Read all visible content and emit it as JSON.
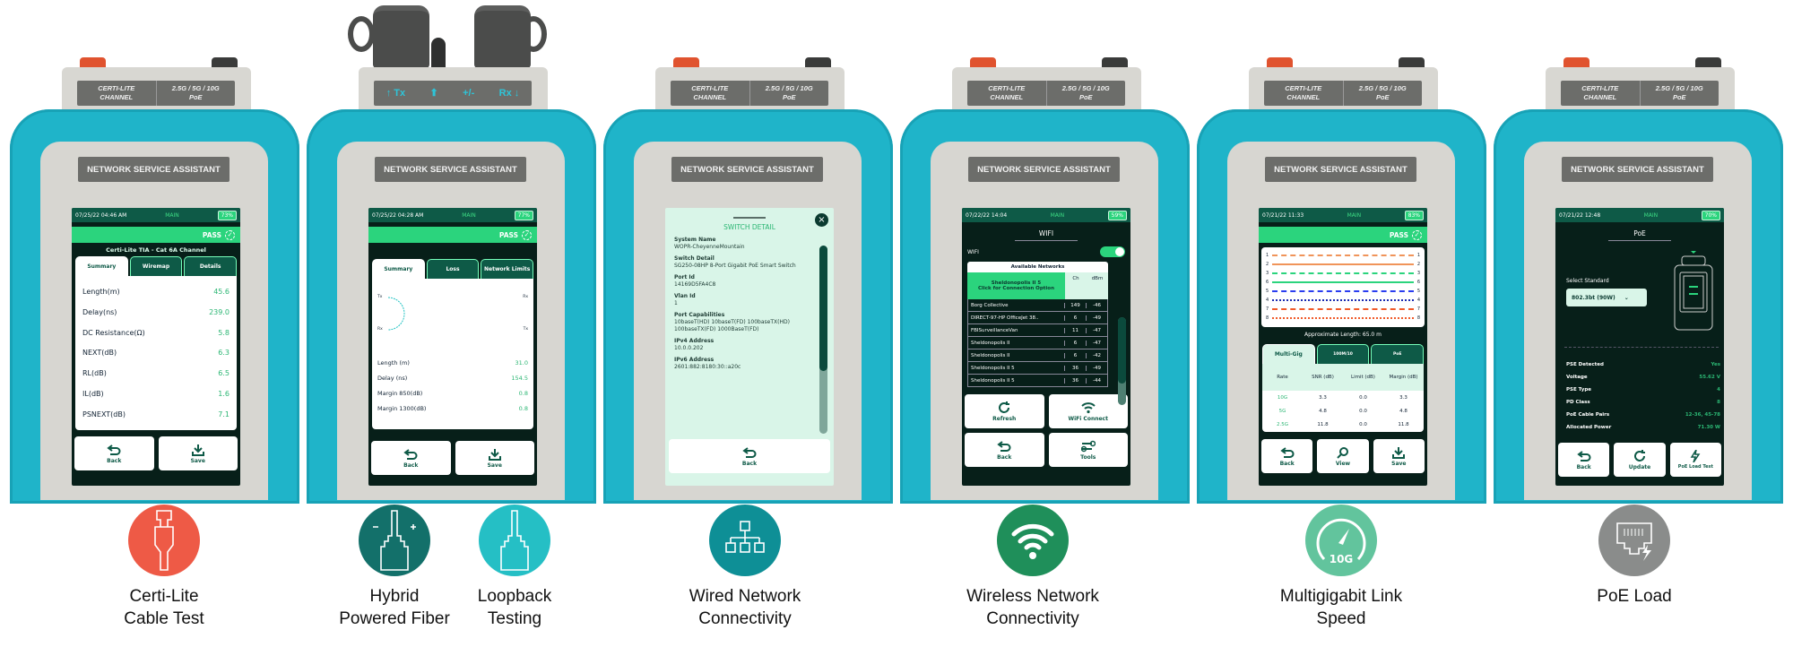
{
  "brand_label": "NETWORK SERVICE ASSISTANT",
  "port_label": {
    "left_line1": "CERTI-LITE",
    "left_line2": "CHANNEL",
    "right_line1": "2.5G / 5G / 10G",
    "right_line2": "PoE"
  },
  "fiber_port_label": {
    "tx": "Tx",
    "pm": "+/-",
    "rx": "Rx"
  },
  "colors": {
    "bumper": "#1fb4c9",
    "screen_header": "#0e5a47",
    "accent_green": "#2bd47d",
    "value_green": "#2bb673"
  },
  "certi": {
    "status": {
      "datetime": "07/25/22 04:46 AM",
      "mode": "MAIN",
      "battery": "73%"
    },
    "result": "PASS",
    "title": "Certi-Lite TIA - Cat 6A Channel",
    "tabs": [
      "Summary",
      "Wiremap",
      "Details"
    ],
    "rows": [
      {
        "label": "Length(m)",
        "value": "45.6"
      },
      {
        "label": "Delay(ns)",
        "value": "239.0"
      },
      {
        "label": "DC Resistance(Ω)",
        "value": "5.8"
      },
      {
        "label": "NEXT(dB)",
        "value": "6.3"
      },
      {
        "label": "RL(dB)",
        "value": "6.5"
      },
      {
        "label": "IL(dB)",
        "value": "1.6"
      },
      {
        "label": "PSNEXT(dB)",
        "value": "7.1"
      }
    ],
    "buttons": {
      "back": "Back",
      "save": "Save"
    }
  },
  "fiber": {
    "status": {
      "datetime": "07/25/22 04:28 AM",
      "mode": "MAIN",
      "battery": "77%"
    },
    "result": "PASS",
    "tabs": [
      "Summary",
      "Loss",
      "Network Limits"
    ],
    "diagram": {
      "left_top": "Tx",
      "left_bottom": "Rx",
      "right_top": "Rx",
      "right_bottom": "Tx"
    },
    "rows": [
      {
        "label": "Length (m)",
        "value": "31.0"
      },
      {
        "label": "Delay (ns)",
        "value": "154.5"
      },
      {
        "label": "Margin 850(dB)",
        "value": "0.8"
      },
      {
        "label": "Margin 1300(dB)",
        "value": "0.8"
      }
    ],
    "buttons": {
      "back": "Back",
      "save": "Save"
    }
  },
  "switch": {
    "title": "SWITCH DETAIL",
    "fields": [
      {
        "label": "System Name",
        "value": "WOPR-CheyenneMountain"
      },
      {
        "label": "Switch Detail",
        "value": "SG250-08HP 8-Port Gigabit PoE Smart Switch"
      },
      {
        "label": "Port Id",
        "value": "14169D5FA4C8"
      },
      {
        "label": "Vlan Id",
        "value": "1"
      },
      {
        "label": "Port Capabilities",
        "value": "10baseT(HD) 10baseT(FD) 100baseTX(HD) 100baseTX(FD) 1000BaseT(FD)"
      },
      {
        "label": "IPv4 Address",
        "value": "10.0.0.202"
      },
      {
        "label": "IPv6 Address",
        "value": "2601:882:8180:30::a20c"
      }
    ],
    "buttons": {
      "back": "Back"
    }
  },
  "wifi": {
    "status": {
      "datetime": "07/22/22 14:04",
      "mode": "MAIN",
      "battery": "59%"
    },
    "title": "WIFI",
    "toggle_label": "WIFI",
    "toggle_on": true,
    "table_title": "Available Networks",
    "selected": {
      "name": "Sheldonopolis II 5",
      "hint": "Click for Connection Option"
    },
    "columns": {
      "ch": "Ch",
      "dbm": "dBm"
    },
    "networks": [
      {
        "name": "Borg Collective",
        "ch": "149",
        "dbm": "-46"
      },
      {
        "name": "DIRECT-97-HP OfficeJet 38..",
        "ch": "6",
        "dbm": "-49"
      },
      {
        "name": "FBISurveillanceVan",
        "ch": "11",
        "dbm": "-47"
      },
      {
        "name": "Sheldonopolis II",
        "ch": "6",
        "dbm": "-47"
      },
      {
        "name": "Sheldonopolis II",
        "ch": "6",
        "dbm": "-42"
      },
      {
        "name": "Sheldonopolis II 5",
        "ch": "36",
        "dbm": "-49"
      },
      {
        "name": "Sheldonopolis II 5",
        "ch": "36",
        "dbm": "-44"
      }
    ],
    "buttons": {
      "refresh": "Refresh",
      "connect": "WiFi Connect",
      "back": "Back",
      "tools": "Tools"
    }
  },
  "multigig": {
    "status": {
      "datetime": "07/21/22 11:33",
      "mode": "MAIN",
      "battery": "83%"
    },
    "result": "PASS",
    "pins": [
      "1",
      "2",
      "3",
      "6",
      "5",
      "4",
      "7",
      "8"
    ],
    "length": "Approximate Length: 65.0 m",
    "tabs": [
      "Multi-Gig",
      "100M/10",
      "PoE"
    ],
    "columns": [
      "Rate",
      "SNR (dB)",
      "Limit (dB)",
      "Margin (dB)"
    ],
    "rows": [
      [
        "10G",
        "3.3",
        "0.0",
        "3.3"
      ],
      [
        "5G",
        "4.8",
        "0.0",
        "4.8"
      ],
      [
        "2.5G",
        "11.8",
        "0.0",
        "11.8"
      ]
    ],
    "buttons": {
      "back": "Back",
      "view": "View",
      "save": "Save"
    }
  },
  "poe": {
    "status": {
      "datetime": "07/21/22 12:48",
      "mode": "MAIN",
      "battery": "70%"
    },
    "title": "PoE",
    "select_label": "Select Standard",
    "select_value": "802.3bt (90W)",
    "rows": [
      {
        "label": "PSE Detected",
        "value": "Yes"
      },
      {
        "label": "Voltage",
        "value": "55.62 V"
      },
      {
        "label": "PSE Type",
        "value": "4"
      },
      {
        "label": "PD Class",
        "value": "8"
      },
      {
        "label": "PoE Cable Pairs",
        "value": "12-36, 45-78"
      },
      {
        "label": "Allocated Power",
        "value": "71.30 W"
      }
    ],
    "buttons": {
      "back": "Back",
      "update": "Update",
      "load": "PoE Load Test"
    }
  },
  "features": [
    {
      "line1": "Certi-Lite",
      "line2": "Cable Test",
      "icon": "ethernet-plug-icon",
      "color": "#ee5a46"
    },
    {
      "line1": "Hybrid",
      "line2": "Powered Fiber",
      "icon": "hybrid-fiber-icon",
      "color": "#13706a"
    },
    {
      "line1": "Loopback",
      "line2": "Testing",
      "icon": "fiber-connector-icon",
      "color": "#25bfc5"
    },
    {
      "line1": "Wired Network",
      "line2": "Connectivity",
      "icon": "network-tree-icon",
      "color": "#0e8f96"
    },
    {
      "line1": "Wireless Network",
      "line2": "Connectivity",
      "icon": "wifi-icon",
      "color": "#1f8f5a"
    },
    {
      "line1": "Multigigabit Link",
      "line2": "Speed",
      "icon": "speedometer-icon",
      "color": "#62c49d",
      "badge": "10G"
    },
    {
      "line1": "PoE Load",
      "icon": "poe-port-icon",
      "color": "#8a8c8b"
    }
  ]
}
